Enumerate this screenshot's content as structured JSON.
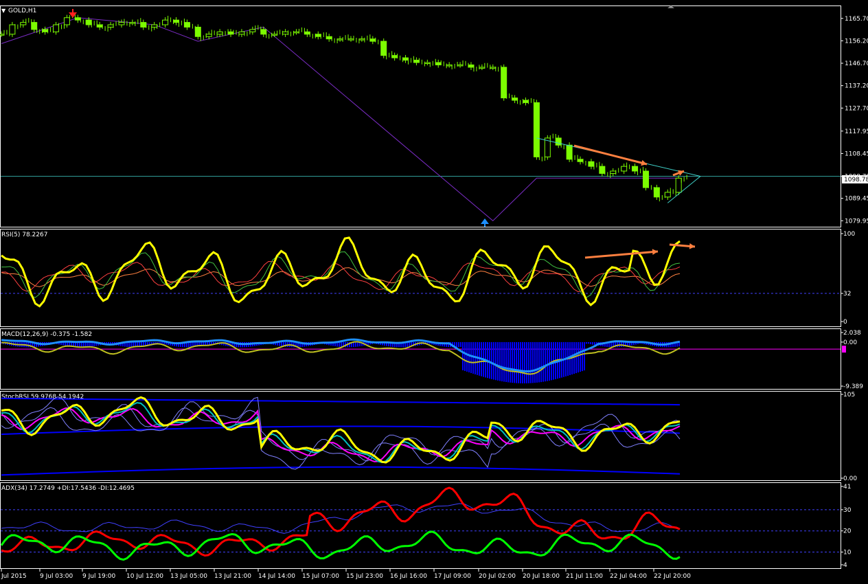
{
  "window": {
    "symbol_label": "GOLD,H1",
    "current_price": "1098.78"
  },
  "colors": {
    "background": "#000000",
    "frame": "#ffffff",
    "candle": "#7CFC00",
    "zigzag": "#7a2cc4",
    "trendline": "#3fd0c8",
    "arrow_annotation": "#ff8040",
    "rsi_line": "#ffff00",
    "macd_hist": "#0000ff",
    "macd_signal": "#1e90ff",
    "stoch_fast": "#ffff00",
    "stoch_slow": "#ff00ff",
    "band": "#0000ff",
    "adx_plus": "#00ff00",
    "adx_minus": "#ff0000",
    "adx_main": "#4040ff"
  },
  "chart_data": [
    {
      "type": "line",
      "name": "price-panel",
      "title": "GOLD,H1",
      "y_ticks": [
        "1165.70",
        "1156.20",
        "1146.70",
        "1137.20",
        "1127.70",
        "1117.95",
        "1108.45",
        "1098.78",
        "1089.45",
        "1079.95"
      ],
      "ylim": [
        1078,
        1170
      ],
      "x_ticks": [
        "Jul 2015",
        "9 Jul 03:00",
        "9 Jul 19:00",
        "10 Jul 12:00",
        "13 Jul 05:00",
        "13 Jul 21:00",
        "14 Jul 14:00",
        "15 Jul 07:00",
        "15 Jul 23:00",
        "16 Jul 16:00",
        "17 Jul 09:00",
        "20 Jul 02:00",
        "20 Jul 18:00",
        "21 Jul 11:00",
        "22 Jul 04:00",
        "22 Jul 20:00"
      ],
      "series": [
        {
          "x": [
            0,
            4,
            8,
            12,
            16,
            20,
            24,
            28,
            32,
            36,
            40,
            44,
            48,
            52,
            56,
            60,
            64,
            68,
            72,
            76,
            80,
            84,
            88,
            92,
            96,
            100,
            104,
            108,
            112,
            116,
            120,
            124,
            128,
            132,
            136,
            140,
            144,
            148,
            152,
            156,
            160,
            164,
            168,
            172,
            176,
            180,
            184,
            188,
            192,
            196,
            200,
            204,
            208,
            212,
            216,
            220,
            224,
            228,
            232,
            236,
            240,
            244,
            248
          ],
          "values": [
            1159,
            1163,
            1164,
            1161,
            1160,
            1163,
            1166,
            1165,
            1163,
            1162,
            1163,
            1164,
            1164,
            1162,
            1163,
            1165,
            1164,
            1162,
            1158,
            1159,
            1160,
            1159,
            1160,
            1161,
            1159,
            1159,
            1160,
            1160,
            1159,
            1158,
            1157,
            1157,
            1157,
            1157,
            1156,
            1150,
            1149,
            1148,
            1147,
            1147,
            1146,
            1146,
            1146,
            1145,
            1145,
            1145,
            1132,
            1131,
            1130,
            1107,
            1115,
            1112,
            1106,
            1105,
            1103,
            1100,
            1101,
            1103,
            1101,
            1094,
            1090,
            1092,
            1098
          ]
        }
      ],
      "current_line": 1098.78,
      "zigzag": [
        [
          0,
          1155
        ],
        [
          28,
          1166
        ],
        [
          56,
          1163
        ],
        [
          72,
          1156
        ],
        [
          96,
          1162
        ],
        [
          180,
          1079.95
        ],
        [
          196,
          1098
        ],
        [
          248,
          1098
        ]
      ]
    },
    {
      "type": "line",
      "name": "rsi-panel",
      "title": "RSI(5) 78.2267",
      "y_ticks": [
        "100",
        "32",
        "0"
      ],
      "ylim": [
        0,
        100
      ],
      "levels": [
        32
      ]
    },
    {
      "type": "bar",
      "name": "macd-panel",
      "title": "MACD(12,26,9) -0.375 -1.582",
      "y_ticks": [
        "2.038",
        "0.00",
        "-9.389"
      ],
      "ylim": [
        -9.389,
        2.038
      ]
    },
    {
      "type": "line",
      "name": "stochrsi-panel",
      "title": "StochRSI 59.9768 54.1942",
      "y_ticks": [
        "105",
        "0.00"
      ],
      "ylim": [
        0,
        105
      ]
    },
    {
      "type": "line",
      "name": "adx-panel",
      "title": "ADX(34) 17.2749 +DI:17.5436 -DI:12.4695",
      "y_ticks": [
        "41",
        "30",
        "20",
        "10",
        "4"
      ],
      "ylim": [
        4,
        41
      ],
      "levels": [
        30,
        20,
        10
      ]
    }
  ]
}
